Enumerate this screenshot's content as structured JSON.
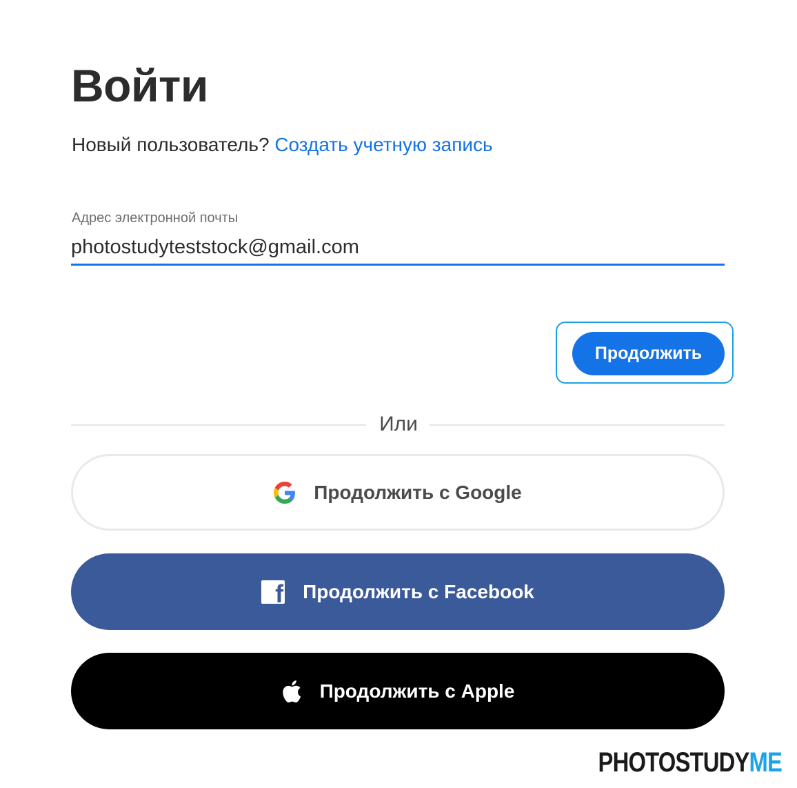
{
  "header": {
    "title": "Войти"
  },
  "signup": {
    "prompt": "Новый пользователь?",
    "link": "Создать учетную запись"
  },
  "email": {
    "label": "Адрес электронной почты",
    "value": "photostudyteststock@gmail.com"
  },
  "continue_button": {
    "label": "Продолжить"
  },
  "divider": {
    "text": "Или"
  },
  "social": {
    "google": {
      "label": "Продолжить с Google",
      "icon": "google-icon"
    },
    "facebook": {
      "label": "Продолжить с Facebook",
      "icon": "facebook-icon"
    },
    "apple": {
      "label": "Продолжить с Apple",
      "icon": "apple-icon"
    }
  },
  "brand": {
    "part1": "PHOTOSTUDY",
    "part2": "ME"
  },
  "colors": {
    "accent": "#1473e6",
    "facebook": "#3b5a9a",
    "apple": "#000000",
    "brand_accent": "#1aa3e8"
  }
}
